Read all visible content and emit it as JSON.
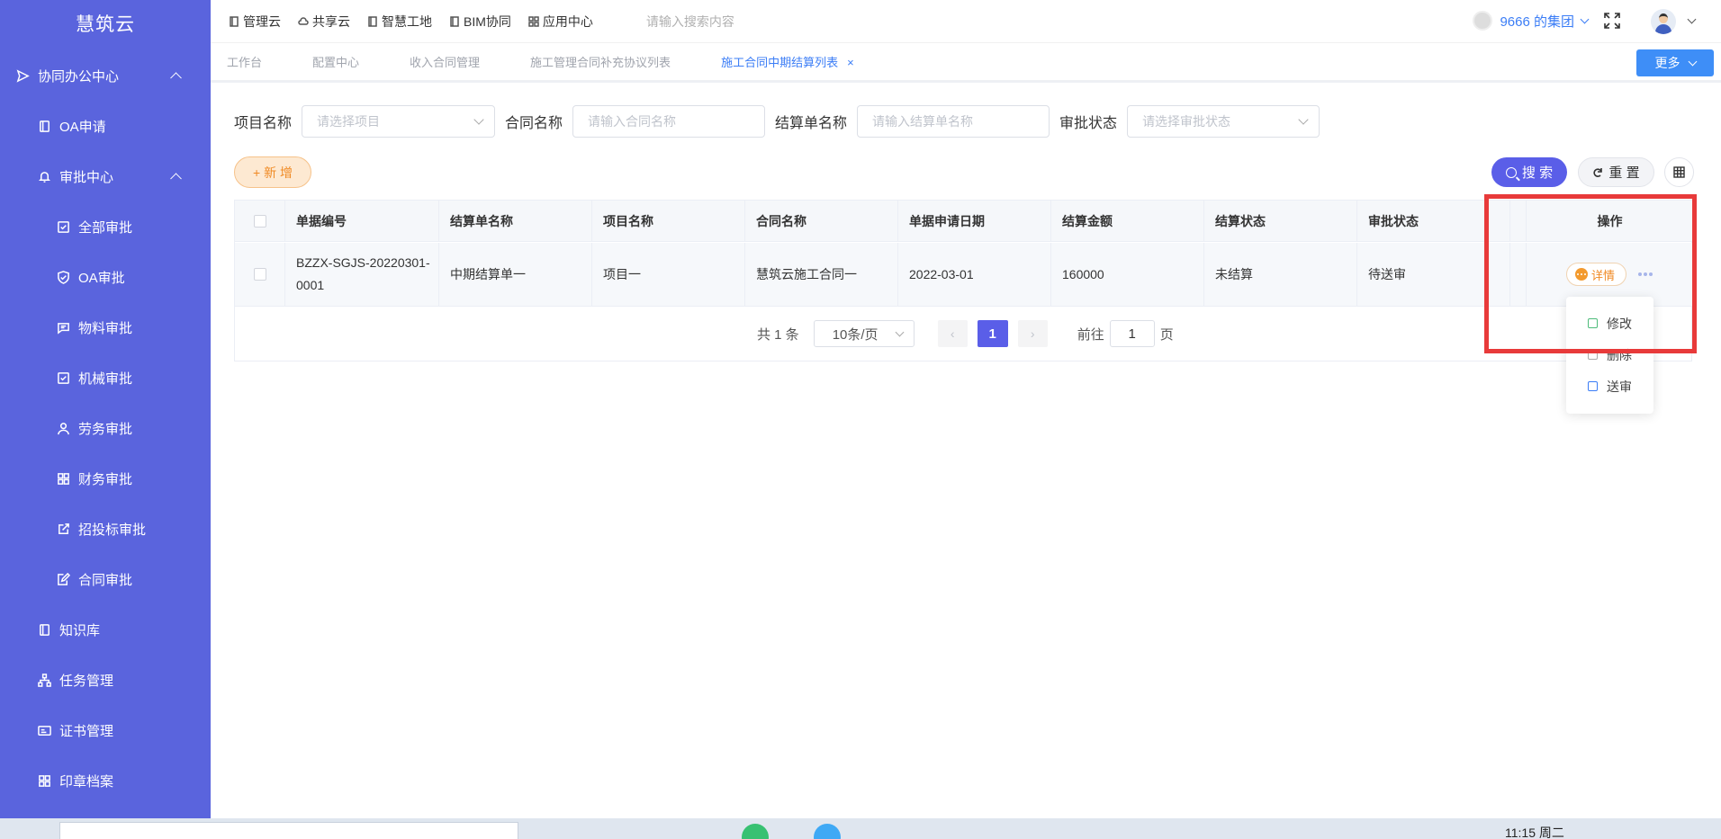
{
  "app": {
    "brand": "慧筑云"
  },
  "sidebar": {
    "items": [
      {
        "label": "协同办公中心",
        "icon": "send-icon"
      },
      {
        "label": "OA申请",
        "icon": "document-icon"
      },
      {
        "label": "审批中心",
        "icon": "bell-icon"
      },
      {
        "label": "全部审批",
        "icon": "checkbox-icon"
      },
      {
        "label": "OA审批",
        "icon": "shield-check-icon"
      },
      {
        "label": "物料审批",
        "icon": "message-icon"
      },
      {
        "label": "机械审批",
        "icon": "checkbox-icon"
      },
      {
        "label": "劳务审批",
        "icon": "user-icon"
      },
      {
        "label": "财务审批",
        "icon": "grid-icon"
      },
      {
        "label": "招投标审批",
        "icon": "external-edit-icon"
      },
      {
        "label": "合同审批",
        "icon": "edit-document-icon"
      },
      {
        "label": "知识库",
        "icon": "book-icon"
      },
      {
        "label": "任务管理",
        "icon": "org-chart-icon"
      },
      {
        "label": "证书管理",
        "icon": "certificate-icon"
      },
      {
        "label": "印章档案",
        "icon": "grid-icon"
      }
    ]
  },
  "topbar": {
    "nav": [
      {
        "label": "管理云",
        "icon": "book-icon"
      },
      {
        "label": "共享云",
        "icon": "cloud-icon"
      },
      {
        "label": "智慧工地",
        "icon": "book-icon"
      },
      {
        "label": "BIM协同",
        "icon": "book-icon"
      },
      {
        "label": "应用中心",
        "icon": "grid-icon"
      }
    ],
    "search_placeholder": "请输入搜索内容",
    "org_name": "9666 的集团"
  },
  "tabs": {
    "items": [
      {
        "label": "工作台"
      },
      {
        "label": "配置中心"
      },
      {
        "label": "收入合同管理"
      },
      {
        "label": "施工管理合同补充协议列表"
      },
      {
        "label": "施工合同中期结算列表",
        "close": "×"
      }
    ],
    "more_label": "更多"
  },
  "filters": {
    "project_label": "项目名称",
    "project_placeholder": "请选择项目",
    "contract_label": "合同名称",
    "contract_placeholder": "请输入合同名称",
    "settlement_label": "结算单名称",
    "settlement_placeholder": "请输入结算单名称",
    "status_label": "审批状态",
    "status_placeholder": "请选择审批状态"
  },
  "actions": {
    "add_label": "+ 新 增",
    "search_label": "搜 索",
    "reset_label": "重 置"
  },
  "table": {
    "columns": [
      "单据编号",
      "结算单名称",
      "项目名称",
      "合同名称",
      "单据申请日期",
      "结算金额",
      "结算状态",
      "审批状态",
      "操作"
    ],
    "rows": [
      {
        "code": "BZZX-SGJS-20220301-0001",
        "settlement_name": "中期结算单一",
        "project": "项目一",
        "contract": "慧筑云施工合同一",
        "date": "2022-03-01",
        "amount": "160000",
        "settle_status": "未结算",
        "approval_status": "待送审",
        "detail_label": "详情"
      }
    ]
  },
  "pagination": {
    "total_text": "共 1 条",
    "page_size": "10条/页",
    "current_page": "1",
    "goto_prefix": "前往",
    "goto_value": "1",
    "goto_suffix": "页"
  },
  "row_menu": {
    "items": [
      {
        "label": "修改",
        "icon": "edit-icon"
      },
      {
        "label": "删除",
        "icon": "delete-icon"
      },
      {
        "label": "送审",
        "icon": "submit-icon"
      }
    ]
  },
  "taskbar": {
    "clock": "11:15 周二"
  },
  "colors": {
    "sidebar_bg": "#5a64dd",
    "primary": "#5a5ee8",
    "link": "#3b7df6",
    "warning": "#f08a24",
    "highlight": "#e83a3a"
  }
}
